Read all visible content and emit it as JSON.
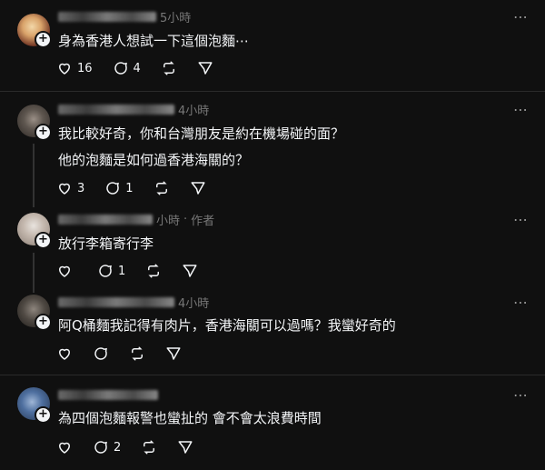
{
  "posts": [
    {
      "name_blur": "user one",
      "time": "5小時",
      "author_tag": "",
      "lines": [
        "身為香港人想試一下這個泡麵⋯"
      ],
      "counts": {
        "likes": "16",
        "comments": "4",
        "reposts": "",
        "shares": ""
      }
    },
    {
      "name_blur": "user two",
      "time": "4小時",
      "author_tag": "",
      "lines": [
        "我比較好奇，你和台灣朋友是約在機場碰的面？",
        "他的泡麵是如何過香港海關的？"
      ],
      "counts": {
        "likes": "3",
        "comments": "1",
        "reposts": "",
        "shares": ""
      }
    },
    {
      "name_blur": "user three",
      "time": "小時",
      "author_tag": "作者",
      "lines": [
        "放行李箱寄行李"
      ],
      "counts": {
        "likes": "",
        "comments": "1",
        "reposts": "",
        "shares": ""
      }
    },
    {
      "name_blur": "user four",
      "time": "4小時",
      "author_tag": "",
      "lines": [
        "阿Q桶麵我記得有肉片，香港海關可以過嗎？我蠻好奇的"
      ],
      "counts": {
        "likes": "",
        "comments": "",
        "reposts": "",
        "shares": ""
      }
    },
    {
      "name_blur": "user five",
      "time": "",
      "author_tag": "",
      "lines": [
        "為四個泡麵報警也蠻扯的 會不會太浪費時間"
      ],
      "counts": {
        "likes": "",
        "comments": "2",
        "reposts": "",
        "shares": ""
      }
    }
  ],
  "icons": {
    "more": "more-icon",
    "like": "heart-icon",
    "comment": "comment-icon",
    "repost": "repost-icon",
    "share": "share-icon",
    "follow": "plus-icon"
  },
  "colors": {
    "background": "#101010",
    "text": "#f3f5f7",
    "muted": "#777777"
  },
  "more_label": "⋯",
  "follow_label": "+",
  "dot_separator": "·"
}
